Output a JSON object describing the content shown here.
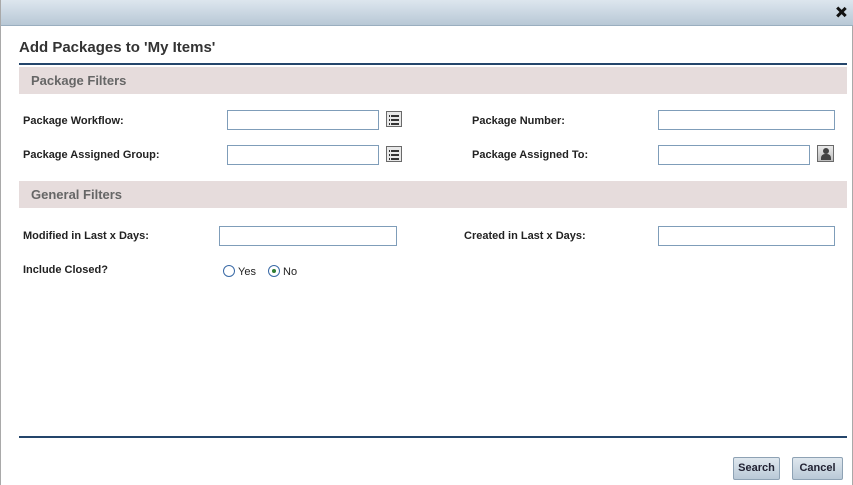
{
  "dialog": {
    "title": "Add Packages to 'My Items'"
  },
  "package_filters": {
    "header": "Package Filters",
    "workflow_label": "Package Workflow:",
    "workflow_value": "",
    "number_label": "Package Number:",
    "number_value": "",
    "assigned_group_label": "Package Assigned Group:",
    "assigned_group_value": "",
    "assigned_to_label": "Package Assigned To:",
    "assigned_to_value": ""
  },
  "general_filters": {
    "header": "General Filters",
    "modified_label": "Modified in Last x Days:",
    "modified_value": "",
    "created_label": "Created in Last x Days:",
    "created_value": "",
    "include_closed_label": "Include Closed?",
    "yes_label": "Yes",
    "no_label": "No",
    "include_closed_selected": "No"
  },
  "buttons": {
    "search": "Search",
    "cancel": "Cancel"
  },
  "icons": {
    "close": "close-icon",
    "list_picker": "list-picker-icon",
    "user_picker": "user-picker-icon"
  },
  "colors": {
    "title_rule": "#24456b",
    "section_bg": "#e6dcdc",
    "titlebar": "#b8c8d6"
  }
}
